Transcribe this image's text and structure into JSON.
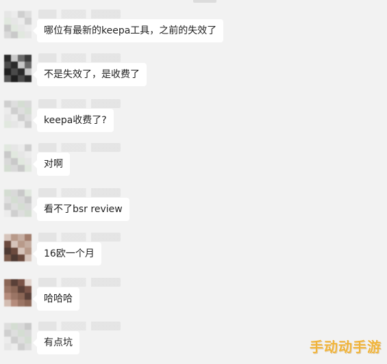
{
  "messages": [
    {
      "text": "哪位有最新的keepa工具，之前的失效了",
      "avatar": "light"
    },
    {
      "text": "不是失效了，是收费了",
      "avatar": "dark"
    },
    {
      "text": "keepa收费了?",
      "avatar": "light"
    },
    {
      "text": "对啊",
      "avatar": "light"
    },
    {
      "text": "看不了bsr review",
      "avatar": "light"
    },
    {
      "text": "16欧一个月",
      "avatar": "brown"
    },
    {
      "text": "哈哈哈",
      "avatar": "brown2"
    },
    {
      "text": "有点坑",
      "avatar": "light"
    }
  ],
  "watermark": "手动动手游",
  "colors": {
    "background": "#f2f2f2",
    "bubble": "#ffffff",
    "watermark": "#f0b43a"
  }
}
